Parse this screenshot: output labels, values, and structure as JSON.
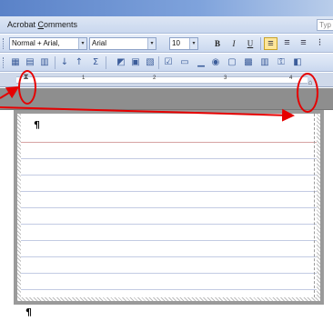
{
  "menubar": {
    "item_label_acc": "C",
    "item_label_rest_1": "Acrobat ",
    "item_label_rest_2": "omments",
    "type_hint": "Typ"
  },
  "toolbar_format": {
    "style_value": "Normal + Arial,",
    "font_value": "Arial",
    "size_value": "10",
    "bold": "B",
    "italic": "I",
    "underline": "U"
  },
  "ruler": {
    "numbers": [
      "1",
      "2",
      "3",
      "4"
    ]
  },
  "document": {
    "paragraph_mark": "¶"
  },
  "icons": {
    "style_arrow": "▾",
    "indent_marker": "hourglass-indent-icon",
    "right_indent": "right-indent-icon"
  },
  "colors": {
    "annotation": "#e60000",
    "title_bar": "#5a82c8"
  }
}
